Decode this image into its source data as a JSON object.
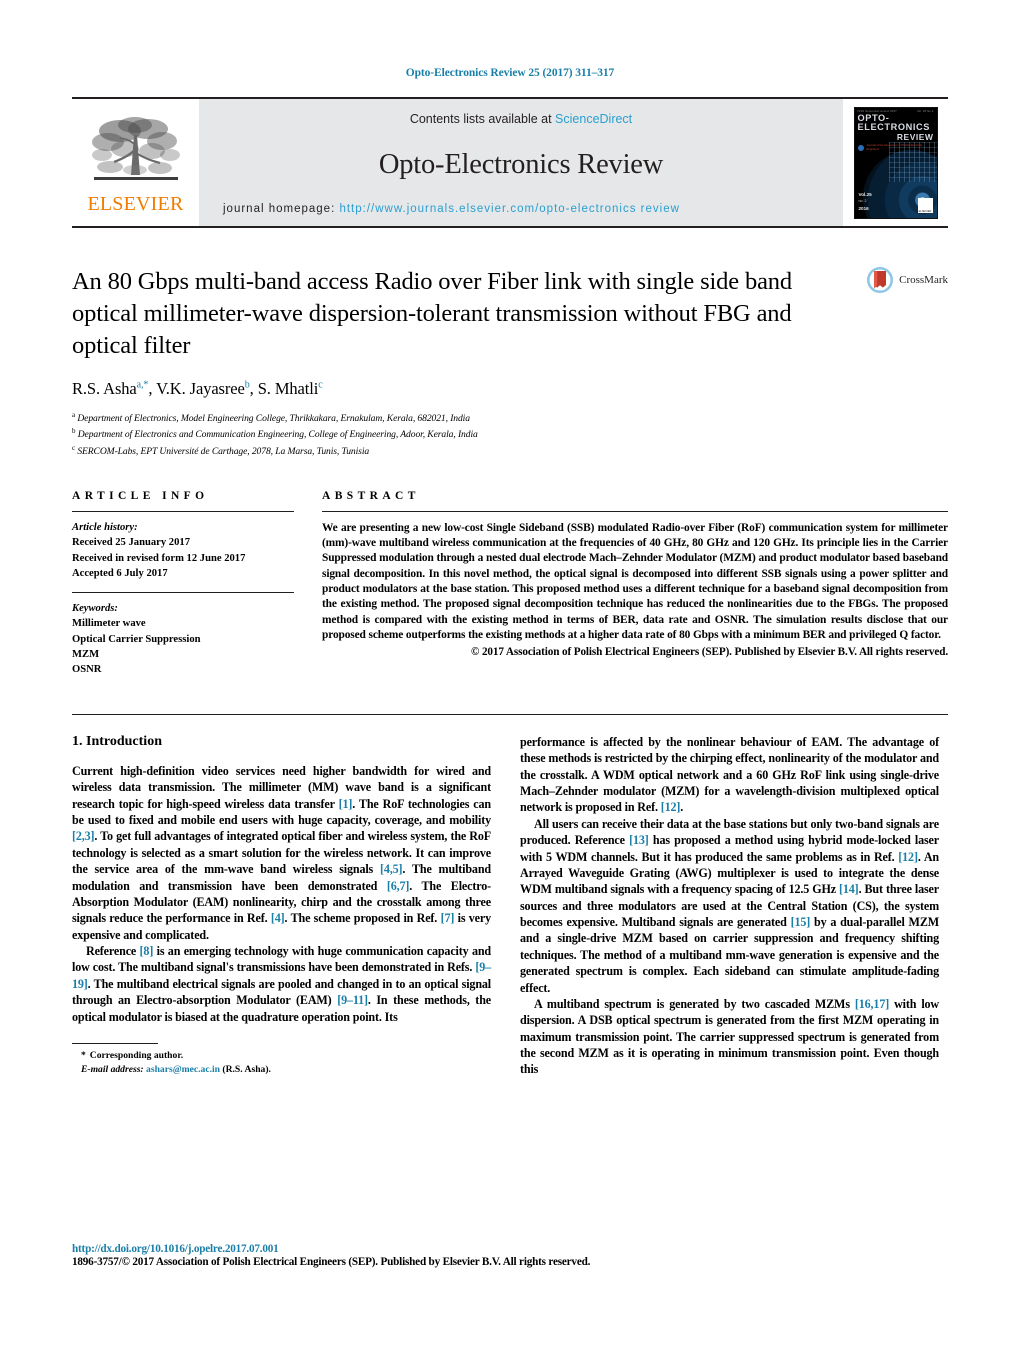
{
  "running_head": "Opto-Electronics Review 25 (2017) 311–317",
  "masthead": {
    "publisher": "ELSEVIER",
    "contents_prefix": "Contents lists available at ",
    "contents_link": "ScienceDirect",
    "journal_name": "Opto-Electronics Review",
    "homepage_prefix": "journal homepage: ",
    "homepage_url": "http://www.journals.elsevier.com/opto-electronics review",
    "link_color": "#2a9fd0",
    "banner_bg": "#e6e7e8",
    "cover": {
      "top_left_tiny": "ISSN Numerical version 0157",
      "top_right_tiny": "Vol. 25 No.4",
      "title_line1": "OPTO-ELECTRONICS",
      "title_line2": "REVIEW",
      "subtitle_left": "Journal of the Association of Polish Electrical Engineers",
      "volume": "Vol.25",
      "issue": "no. 2",
      "year": "2016",
      "publisher_mark": "ELSEVIER"
    }
  },
  "article": {
    "title": "An 80 Gbps multi-band access Radio over Fiber link with single side band optical millimeter-wave dispersion-tolerant transmission without FBG and optical filter",
    "crossmark_label": "CrossMark",
    "authors_html": "R.S. Asha<sup>a,*</sup>, V.K. Jayasree<sup>b</sup>, S. Mhatli<sup>c</sup>",
    "affiliations": [
      {
        "marker": "a",
        "text": "Department of Electronics, Model Engineering College, Thrikkakara, Ernakulam, Kerala, 682021, India"
      },
      {
        "marker": "b",
        "text": "Department of Electronics and Communication Engineering, College of Engineering, Adoor, Kerala, India"
      },
      {
        "marker": "c",
        "text": "SERCOM-Labs, EPT Université de Carthage, 2078, La Marsa, Tunis, Tunisia"
      }
    ]
  },
  "article_info": {
    "heading": "ARTICLE INFO",
    "history_label": "Article history:",
    "history": [
      "Received 25 January 2017",
      "Received in revised form 12 June 2017",
      "Accepted 6 July 2017"
    ],
    "keywords_label": "Keywords:",
    "keywords": [
      "Millimeter wave",
      "Optical Carrier Suppression",
      "MZM",
      "OSNR"
    ]
  },
  "abstract": {
    "heading": "ABSTRACT",
    "text": "We are presenting a new low-cost Single Sideband (SSB) modulated Radio-over Fiber (RoF) communication system for millimeter (mm)-wave multiband wireless communication at the frequencies of 40 GHz, 80 GHz and 120 GHz. Its principle lies in the Carrier Suppressed modulation through a nested dual electrode Mach–Zehnder Modulator (MZM) and product modulator based baseband signal decomposition. In this novel method, the optical signal is decomposed into different SSB signals using a power splitter and product modulators at the base station. This proposed method uses a different technique for a baseband signal decomposition from the existing method. The proposed signal decomposition technique has reduced the nonlinearities due to the FBGs. The proposed method is compared with the existing method in terms of BER, data rate and OSNR. The simulation results disclose that our proposed scheme outperforms the existing methods at a higher data rate of 80 Gbps with a minimum BER and privileged Q factor.",
    "copyright": "© 2017 Association of Polish Electrical Engineers (SEP). Published by Elsevier B.V. All rights reserved."
  },
  "body": {
    "section_number_title": "1.  Introduction",
    "left_paragraphs": [
      "Current high-definition video services need higher bandwidth for wired and wireless data transmission. The millimeter (MM) wave band is a significant research topic for high-speed wireless data transfer [1]. The RoF technologies can be used to fixed and mobile end users with huge capacity, coverage, and mobility [2,3]. To get full advantages of integrated optical fiber and wireless system, the RoF technology is selected as a smart solution for the wireless network. It can improve the service area of the mm-wave band wireless signals [4,5]. The multiband modulation and transmission have been demonstrated [6,7]. The Electro-Absorption Modulator (EAM) nonlinearity, chirp and the crosstalk among three signals reduce the performance in Ref. [4]. The scheme proposed in Ref. [7] is very expensive and complicated.",
      "Reference [8] is an emerging technology with huge communication capacity and low cost. The multiband signal's transmissions have been demonstrated in Refs. [9–19]. The multiband electrical signals are pooled and changed in to an optical signal through an Electro-absorption Modulator (EAM) [9–11]. In these methods, the optical modulator is biased at the quadrature operation point. Its"
    ],
    "right_paragraphs": [
      "performance is affected by the nonlinear behaviour of EAM. The advantage of these methods is restricted by the chirping effect, nonlinearity of the modulator and the crosstalk. A WDM optical network and a 60 GHz RoF link using single-drive Mach–Zehnder modulator (MZM) for a wavelength-division multiplexed optical network is proposed in Ref. [12].",
      "All users can receive their data at the base stations but only two-band signals are produced. Reference [13] has proposed a method using hybrid mode-locked laser with 5 WDM channels. But it has produced the same problems as in Ref. [12]. An Arrayed Waveguide Grating (AWG) multiplexer is used to integrate the dense WDM multiband signals with a frequency spacing of 12.5 GHz [14]. But three laser sources and three modulators are used at the Central Station (CS), the system becomes expensive. Multiband signals are generated [15] by a dual-parallel MZM and a single-drive MZM based on carrier suppression and frequency shifting techniques. The method of a multiband mm-wave generation is expensive and the generated spectrum is complex. Each sideband can stimulate amplitude-fading effect.",
      "A multiband spectrum is generated by two cascaded MZMs [16,17] with low dispersion. A DSB optical spectrum is generated from the first MZM operating in maximum transmission point. The carrier suppressed spectrum is generated from the second MZM as it is operating in minimum transmission point. Even though this"
    ]
  },
  "footnote": {
    "star": "*",
    "corresponding": "Corresponding author.",
    "email_label": "E-mail address:",
    "email": "ashars@mec.ac.in",
    "email_owner": "(R.S. Asha)."
  },
  "page_footer": {
    "doi": "http://dx.doi.org/10.1016/j.opelre.2017.07.001",
    "issn_line": "1896-3757/© 2017 Association of Polish Electrical Engineers (SEP). Published by Elsevier B.V. All rights reserved."
  }
}
